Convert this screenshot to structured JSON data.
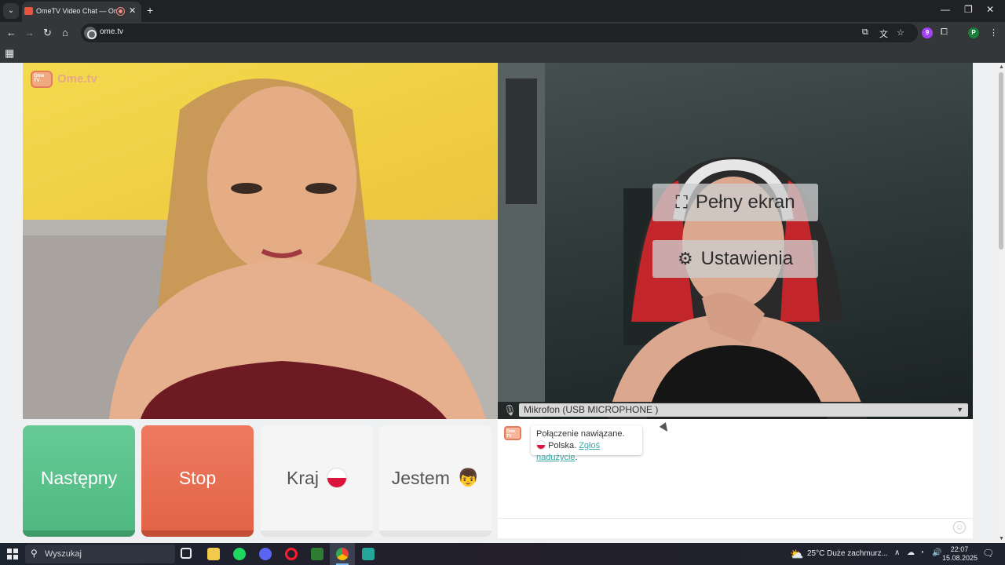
{
  "browser": {
    "tab_title": "OmeTV Video Chat — Ome",
    "url": "ome.tv",
    "tab_close": "✕",
    "new_tab": "+",
    "profile_initial": "P",
    "extension_badge": "9"
  },
  "page": {
    "logo_text": "Ome.tv",
    "logo_small": "Ome TV",
    "overlay": {
      "fullscreen_label": "Pełny ekran",
      "settings_label": "Ustawienia"
    },
    "microphone_select": "Mikrofon (USB MICROPHONE )",
    "buttons": {
      "next": "Następny",
      "stop": "Stop",
      "country": "Kraj",
      "i_am": "Jestem"
    },
    "chat": {
      "status": "Połączenie nawiązane.",
      "country": "Polska.",
      "report_link": "Zgłoś nadużycie",
      "period": "."
    },
    "colors": {
      "next_green": "#5cc28c",
      "stop_red": "#e86d52",
      "link_teal": "#3aa7a7"
    }
  },
  "taskbar": {
    "search_placeholder": "Wyszukaj",
    "weather_temp": "25°C",
    "weather_desc": "Duże zachmurz...",
    "time": "22:07",
    "date": "15.08.2025"
  }
}
